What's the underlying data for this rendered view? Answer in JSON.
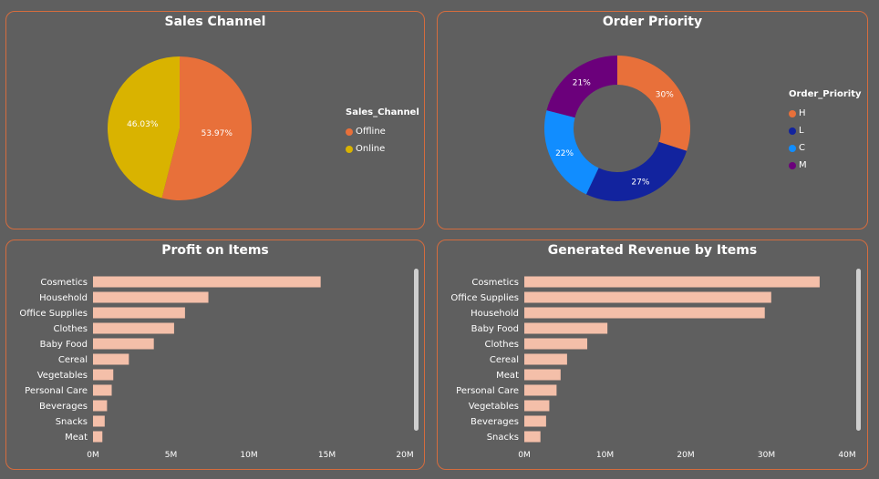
{
  "chart_data": [
    {
      "type": "pie",
      "title": "Sales Channel",
      "legend_title": "Sales_Channel",
      "legend_position": "right",
      "slices": [
        {
          "label": "Offline",
          "value": 53.97,
          "display": "53.97%",
          "color": "#e8703a"
        },
        {
          "label": "Online",
          "value": 46.03,
          "display": "46.03%",
          "color": "#d9b300"
        }
      ]
    },
    {
      "type": "pie",
      "subtype": "donut",
      "title": "Order Priority",
      "legend_title": "Order_Priority",
      "legend_position": "right",
      "slices": [
        {
          "label": "H",
          "value": 30,
          "display": "30%",
          "color": "#e8703a"
        },
        {
          "label": "L",
          "value": 27,
          "display": "27%",
          "color": "#12239e"
        },
        {
          "label": "C",
          "value": 22,
          "display": "22%",
          "color": "#118dff"
        },
        {
          "label": "M",
          "value": 21,
          "display": "21%",
          "color": "#6b007b"
        }
      ]
    },
    {
      "type": "bar",
      "orientation": "horizontal",
      "title": "Profit on Items",
      "categories": [
        "Cosmetics",
        "Household",
        "Office Supplies",
        "Clothes",
        "Baby Food",
        "Cereal",
        "Vegetables",
        "Personal Care",
        "Beverages",
        "Snacks",
        "Meat"
      ],
      "values": [
        14.6,
        7.4,
        5.9,
        5.2,
        3.9,
        2.3,
        1.3,
        1.2,
        0.9,
        0.75,
        0.6
      ],
      "unit": "M",
      "xlim": [
        0,
        20
      ],
      "xticks": [
        "0M",
        "5M",
        "10M",
        "15M",
        "20M"
      ],
      "color": "#f4bfa9"
    },
    {
      "type": "bar",
      "orientation": "horizontal",
      "title": "Generated Revenue by Items",
      "categories": [
        "Cosmetics",
        "Office Supplies",
        "Household",
        "Baby Food",
        "Clothes",
        "Cereal",
        "Meat",
        "Personal Care",
        "Vegetables",
        "Beverages",
        "Snacks"
      ],
      "values": [
        36.6,
        30.6,
        29.8,
        10.3,
        7.8,
        5.3,
        4.5,
        4.0,
        3.1,
        2.7,
        2.0
      ],
      "unit": "M",
      "xlim": [
        0,
        40
      ],
      "xticks": [
        "0M",
        "10M",
        "20M",
        "30M",
        "40M"
      ],
      "color": "#f4bfa9"
    }
  ]
}
